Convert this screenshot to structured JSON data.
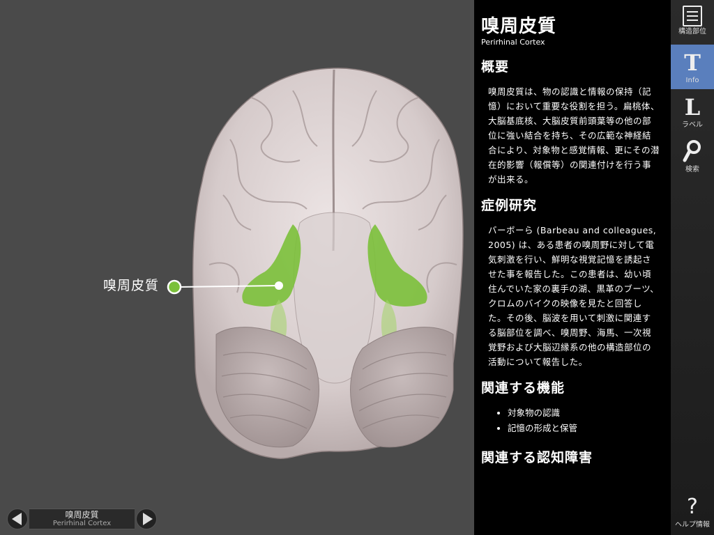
{
  "viewer": {
    "callout_label": "嗅周皮質",
    "highlight_color": "#7bc03a"
  },
  "bottom_nav": {
    "title": "嗅周皮質",
    "subtitle": "Perirhinal Cortex"
  },
  "info": {
    "title": "嗅周皮質",
    "subtitle": "Perirhinal Cortex",
    "sections": [
      {
        "heading": "概要",
        "text": "嗅周皮質は、物の認識と情報の保持（記憶）において重要な役割を担う。扁桃体、大脳基底核、大脳皮質前頭葉等の他の部位に強い結合を持ち、その広範な神経結合により、対象物と感覚情報、更にその潜在的影響（報償等）の関連付けを行う事が出来る。"
      },
      {
        "heading": "症例研究",
        "text": "バーボーら (Barbeau and colleagues, 2005) は、ある患者の嗅周野に対して電気刺激を行い、鮮明な視覚記憶を誘起させた事を報告した。この患者は、幼い頃住んでいた家の裏手の湖、黒革のブーツ、クロムのバイクの映像を見たと回答した。その後、脳波を用いて刺激に関連する脳部位を調べ、嗅周野、海馬、一次視覚野および大脳辺縁系の他の構造部位の活動について報告した。"
      },
      {
        "heading": "関連する機能",
        "items": [
          "対象物の認識",
          "記憶の形成と保管"
        ]
      },
      {
        "heading": "関連する認知障害"
      }
    ]
  },
  "toolbar": {
    "items": [
      {
        "icon": "list-icon",
        "label": "構造部位"
      },
      {
        "icon": "T",
        "label": "Info"
      },
      {
        "icon": "L",
        "label": "ラベル"
      },
      {
        "icon": "magnifier-icon",
        "label": "検索"
      },
      {
        "icon": "?",
        "label": "ヘルプ情報"
      }
    ],
    "active_color": "#5a7fbd"
  }
}
